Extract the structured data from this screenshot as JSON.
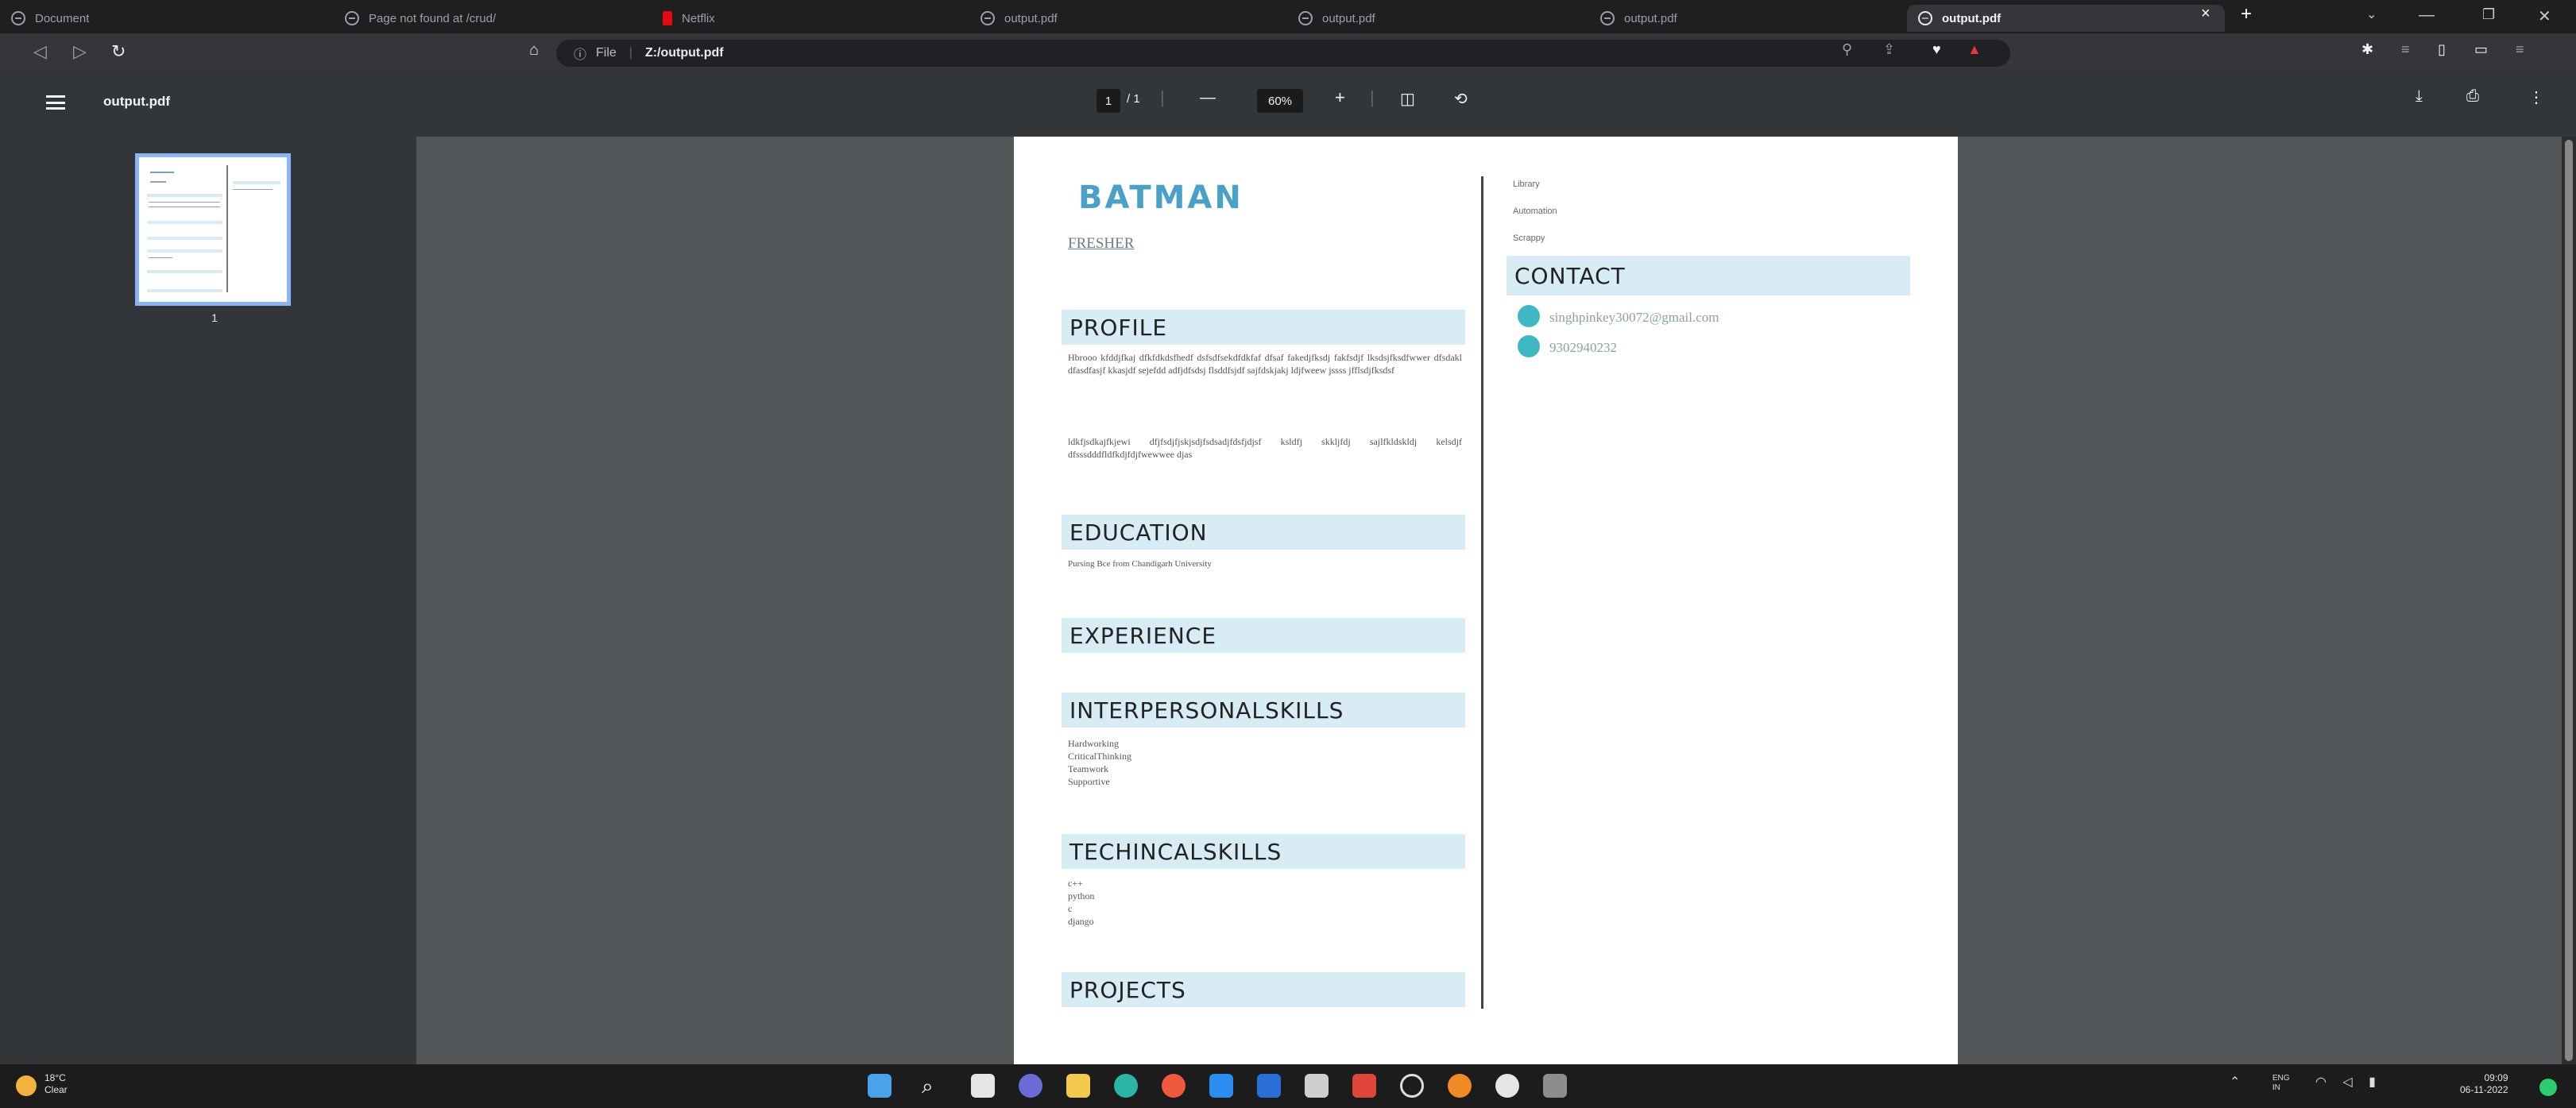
{
  "browser": {
    "tabs": [
      {
        "title": "Document",
        "active": false
      },
      {
        "title": "Page not found at /crud/",
        "active": false
      },
      {
        "title": "Netflix",
        "active": false
      },
      {
        "title": "output.pdf",
        "active": false
      },
      {
        "title": "output.pdf",
        "active": false
      },
      {
        "title": "output.pdf",
        "active": false
      },
      {
        "title": "output.pdf",
        "active": true
      }
    ],
    "new_tab": "+",
    "close_tab": "×",
    "address": {
      "scheme_label": "File",
      "url": "Z:/output.pdf"
    }
  },
  "pdf_toolbar": {
    "title": "output.pdf",
    "page_current": "1",
    "page_total": "/ 1",
    "zoom": "60%",
    "zoom_out": "—",
    "zoom_in": "+"
  },
  "thumbnail": {
    "page_number": "1"
  },
  "resume": {
    "name": "BATMAN",
    "subtitle": "FRESHER",
    "sections": {
      "profile": "PROFILE",
      "education": "EDUCATION",
      "experience": "EXPERIENCE",
      "interpersonal": "INTERPERSONALSKILLS",
      "technical": "TECHINCALSKILLS",
      "projects": "PROJECTS",
      "contact": "CONTACT"
    },
    "profile_text_1": "Hbrooo kfddjfkaj dfkfdkdsfhedf dsfsdfsekdfdkfaf dfsaf fakedjfksdj fakfsdjf lksdsjfksdfwwer dfsdakl dfasdfasjf kkasjdf sejefdd adfjdfsdsj flsddfsjdf sajfdskjakj ldjfweew jssss jfflsdjfksdsf",
    "profile_text_2": "ldkfjsdkajfkjewi dfjfsdjfjskjsdjfsdsadjfdsfjdjsf ksldfj skkljfdj sajlfkldskldj kelsdjf dfsssdddfldfkdjfdjfwewwee djas",
    "education_text": "Pursing Bce from Chandigarh University",
    "interpersonal_skills": [
      "Hardworking",
      "CriticalThinking",
      "Teamwork",
      "Supportive"
    ],
    "technical_skills": [
      "c++",
      "python",
      "c",
      "django"
    ],
    "right_column_items": [
      "Library",
      "Automation",
      "Scrappy"
    ],
    "email": "singhpinkey30072@gmail.com",
    "phone": "9302940232"
  },
  "taskbar": {
    "weather_temp": "18°C",
    "weather_desc": "Clear",
    "language": "ENG",
    "region": "IN",
    "time": "09:09",
    "date": "06-11-2022"
  },
  "colors": {
    "heading_bg": "#d7ecf4",
    "name_color": "#4aa1c7",
    "contact_icon": "#3fb8c4"
  }
}
